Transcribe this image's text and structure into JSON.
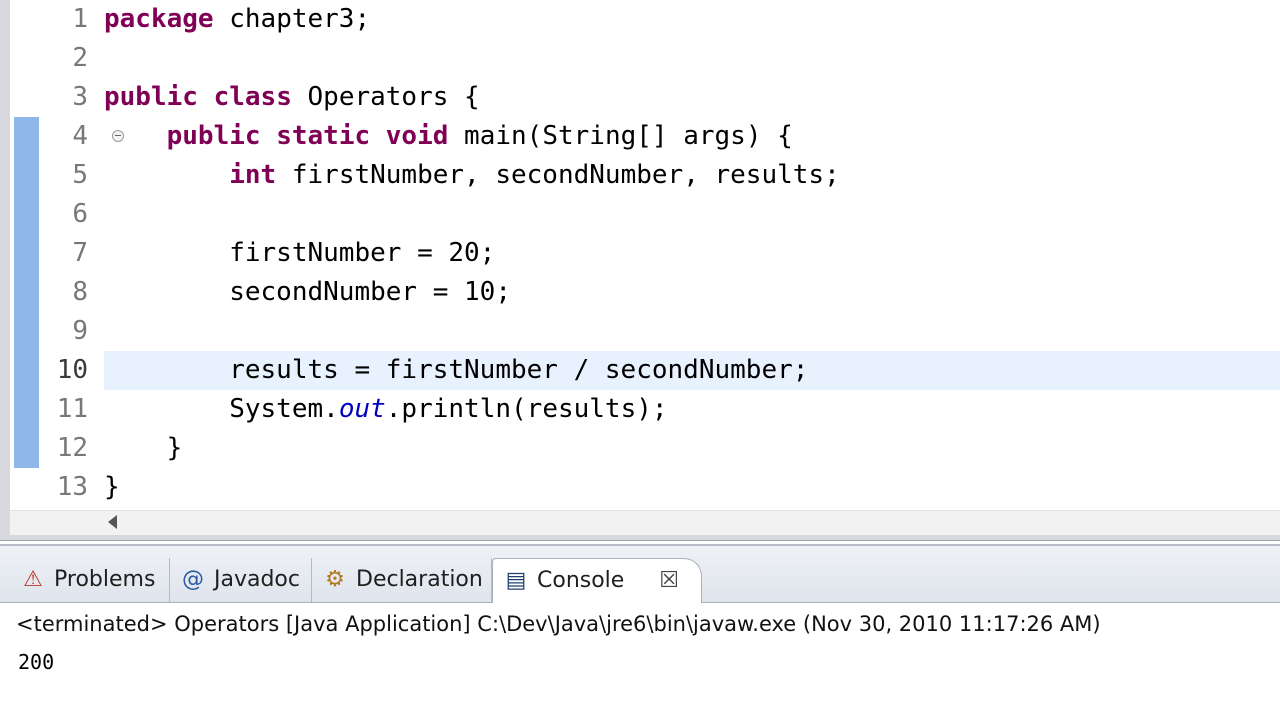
{
  "editor": {
    "line_numbers": [
      "1",
      "2",
      "3",
      "4",
      "5",
      "6",
      "7",
      "8",
      "9",
      "10",
      "11",
      "12",
      "13"
    ],
    "current_line": 10,
    "lines": [
      [
        {
          "t": "package",
          "c": "kw"
        },
        {
          "t": " chapter3;",
          "c": ""
        }
      ],
      [],
      [
        {
          "t": "public",
          "c": "kw"
        },
        {
          "t": " ",
          "c": ""
        },
        {
          "t": "class",
          "c": "kw"
        },
        {
          "t": " Operators {",
          "c": ""
        }
      ],
      [
        {
          "t": "    ",
          "c": ""
        },
        {
          "t": "public",
          "c": "kw"
        },
        {
          "t": " ",
          "c": ""
        },
        {
          "t": "static",
          "c": "kw"
        },
        {
          "t": " ",
          "c": ""
        },
        {
          "t": "void",
          "c": "kw"
        },
        {
          "t": " main(String[] args) {",
          "c": ""
        }
      ],
      [
        {
          "t": "        ",
          "c": ""
        },
        {
          "t": "int",
          "c": "kw"
        },
        {
          "t": " firstNumber, secondNumber, results;",
          "c": ""
        }
      ],
      [],
      [
        {
          "t": "        firstNumber = 20;",
          "c": ""
        }
      ],
      [
        {
          "t": "        secondNumber = 10;",
          "c": ""
        }
      ],
      [],
      [
        {
          "t": "        results = firstNumber / secondNumber;",
          "c": ""
        }
      ],
      [
        {
          "t": "        System.",
          "c": ""
        },
        {
          "t": "out",
          "c": "field"
        },
        {
          "t": ".println(results);",
          "c": ""
        }
      ],
      [
        {
          "t": "    }",
          "c": ""
        }
      ],
      [
        {
          "t": "}",
          "c": ""
        }
      ]
    ]
  },
  "tabs": [
    {
      "label": "Problems",
      "icon": "problems-icon",
      "glyph": "⚠"
    },
    {
      "label": "Javadoc",
      "icon": "javadoc-icon",
      "glyph": "@"
    },
    {
      "label": "Declaration",
      "icon": "declaration-icon",
      "glyph": "⚙"
    },
    {
      "label": "Console",
      "icon": "console-icon",
      "glyph": "▤",
      "active": true
    }
  ],
  "console": {
    "close_glyph": "☒",
    "header": "<terminated> Operators [Java Application] C:\\Dev\\Java\\jre6\\bin\\javaw.exe (Nov 30, 2010 11:17:26 AM)",
    "output": "200"
  },
  "colors": {
    "keyword": "#7f0055",
    "field": "#0000c0",
    "current_line": "#e8f2fe",
    "change_bar": "#8eb8ea"
  }
}
